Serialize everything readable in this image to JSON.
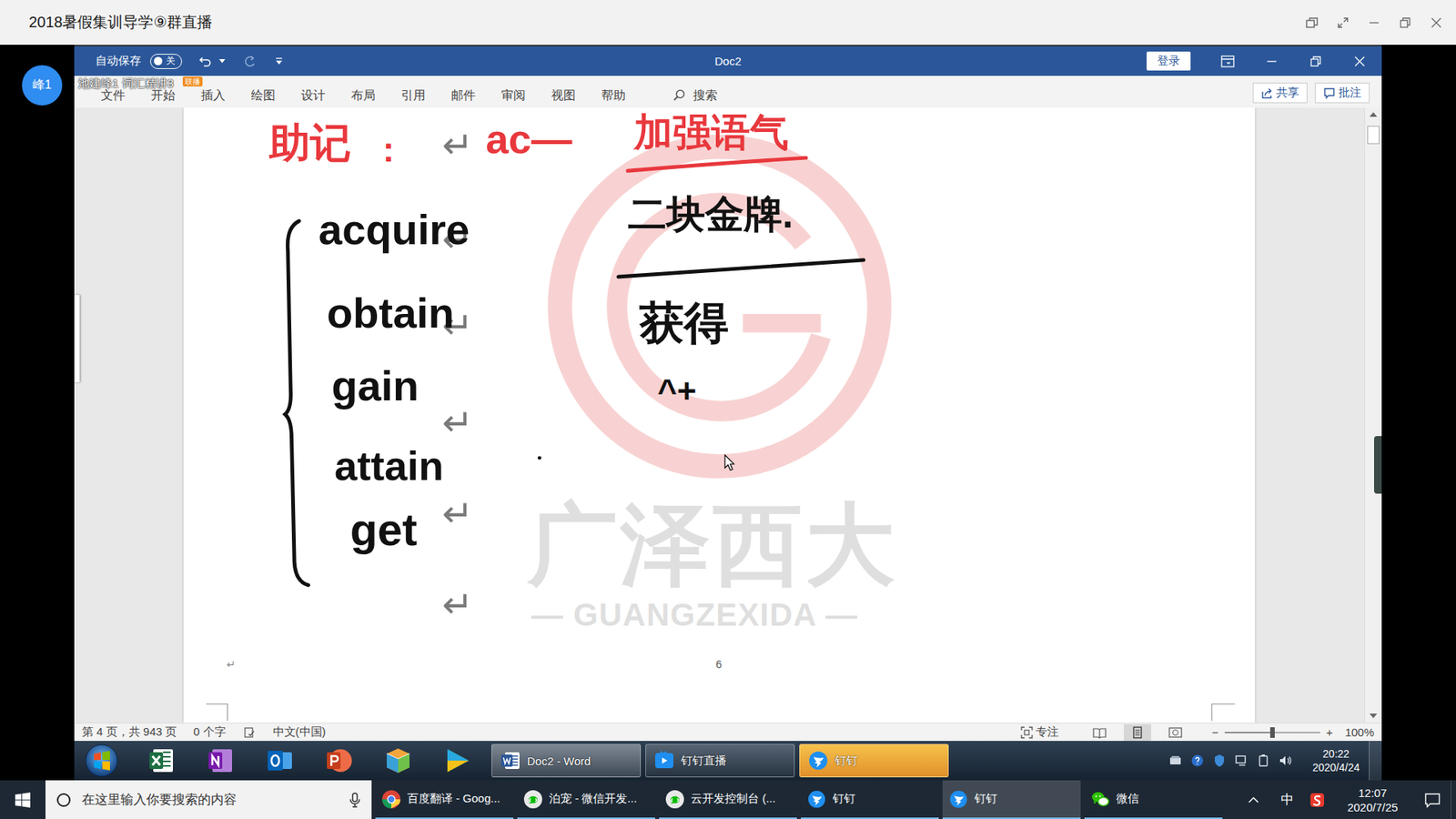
{
  "window": {
    "title": "2018暑假集训导学⑨群直播"
  },
  "presenter": {
    "avatar": "峰1",
    "caption": "池建峰1 词汇精讲3",
    "badge": "联播"
  },
  "word": {
    "autosave": {
      "label": "自动保存",
      "state_text": "关",
      "on": false
    },
    "title": "Doc2",
    "login": "登录",
    "tabs": [
      {
        "label": "文件",
        "selected": false
      },
      {
        "label": "开始",
        "selected": false
      },
      {
        "label": "插入",
        "selected": false
      },
      {
        "label": "绘图",
        "selected": false
      },
      {
        "label": "设计",
        "selected": false
      },
      {
        "label": "布局",
        "selected": false
      },
      {
        "label": "引用",
        "selected": false
      },
      {
        "label": "邮件",
        "selected": false
      },
      {
        "label": "审阅",
        "selected": false
      },
      {
        "label": "视图",
        "selected": false
      },
      {
        "label": "帮助",
        "selected": false
      }
    ],
    "search": "搜索",
    "share": "共享",
    "comment": "批注"
  },
  "document": {
    "notes": [
      {
        "text": "助记",
        "color": "#e8383d"
      },
      {
        "text": ":",
        "color": "#e8383d"
      },
      {
        "text": "ac—",
        "color": "#e8383d"
      },
      {
        "text": "加强语气",
        "color": "#e8383d"
      },
      {
        "text": "acquire",
        "color": "#111111"
      },
      {
        "text": "obtain",
        "color": "#111111"
      },
      {
        "text": "gain",
        "color": "#111111"
      },
      {
        "text": "attain",
        "color": "#111111"
      },
      {
        "text": "get",
        "color": "#111111"
      },
      {
        "text": "二块金牌.",
        "color": "#111111"
      },
      {
        "text": "获得",
        "color": "#111111"
      },
      {
        "text": "^+",
        "color": "#111111"
      }
    ],
    "paragraph_marks": [
      "↵",
      "↵",
      "↵",
      "↵",
      "↵",
      "↵"
    ],
    "watermark": {
      "name": "广泽西大",
      "latin": "— GUANGZEXIDA —"
    },
    "footer_mark": "↵",
    "page_number": "6"
  },
  "status_bar": {
    "page": "第 4 页，共 943 页",
    "words": "0 个字",
    "language": "中文(中国)",
    "focus": "专注",
    "views": [
      {
        "kind": "read",
        "selected": false
      },
      {
        "kind": "print",
        "selected": true
      },
      {
        "kind": "web",
        "selected": false
      }
    ],
    "zoom": {
      "minus": "−",
      "plus": "+",
      "level": 0.5,
      "reading": "100%"
    }
  },
  "inner_taskbar": {
    "windows": [
      {
        "label": "Doc2 - Word",
        "kind": "word",
        "active": true,
        "highlighted": false
      },
      {
        "label": "钉钉直播",
        "kind": "dinglive",
        "active": false,
        "highlighted": false
      },
      {
        "label": "钉钉",
        "kind": "ding",
        "active": false,
        "highlighted": true
      }
    ],
    "time": "20:22",
    "date": "2020/4/24"
  },
  "taskbar": {
    "search": "在这里输入你要搜索的内容",
    "windows": [
      {
        "label": "百度翻译 - Goog...",
        "kind": "chrome",
        "active": false
      },
      {
        "label": "泊宠 - 微信开发...",
        "kind": "wxdev",
        "active": false
      },
      {
        "label": "云开发控制台 (...",
        "kind": "wxdev",
        "active": false
      },
      {
        "label": "钉钉",
        "kind": "ding",
        "active": false
      },
      {
        "label": "钉钉",
        "kind": "ding",
        "active": true
      },
      {
        "label": "微信",
        "kind": "wechat",
        "active": false
      }
    ],
    "ime": "中",
    "time": "12:07",
    "date": "2020/7/25"
  }
}
